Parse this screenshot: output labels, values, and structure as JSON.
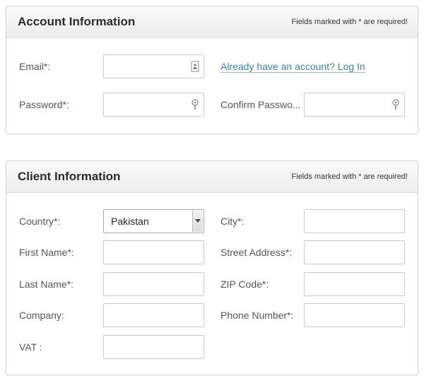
{
  "account": {
    "title": "Account Information",
    "note": "Fields marked with * are required!",
    "email_label": "Email*:",
    "email_value": "",
    "login_link": "Already have an account? Log In",
    "password_label": "Password*:",
    "password_value": "",
    "confirm_label": "Confirm Passwo...",
    "confirm_value": "",
    "email_icon": "contact-card-icon",
    "password_icon": "key-icon"
  },
  "client": {
    "title": "Client Information",
    "note": "Fields marked with * are required!",
    "country_label": "Country*:",
    "country_value": "Pakistan",
    "first_name_label": "First Name*:",
    "last_name_label": "Last Name*:",
    "company_label": "Company:",
    "vat_label": "VAT :",
    "city_label": "City*:",
    "street_label": "Street Address*:",
    "zip_label": "ZIP Code*:",
    "phone_label": "Phone Number*:"
  },
  "colors": {
    "link": "#3a7fb0",
    "header_bg": "#ececec",
    "border": "#d6d6d6"
  }
}
